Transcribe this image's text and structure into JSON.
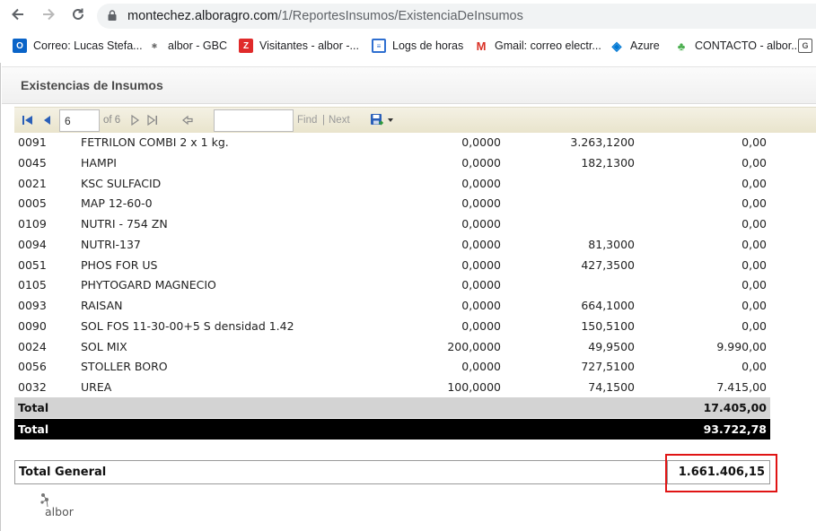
{
  "browser": {
    "url_host": "montechez.alboragro.com",
    "url_path": "/1/ReportesInsumos/ExistenciaDeInsumos",
    "bookmarks": [
      {
        "label": "Correo: Lucas Stefa...",
        "icon": "outlook-icon",
        "color": "#0a64c8"
      },
      {
        "label": "albor - GBC",
        "icon": "albor-icon",
        "color": "#6b6b6b"
      },
      {
        "label": "Visitantes - albor -...",
        "icon": "zoho-icon",
        "color": "#e02a2a"
      },
      {
        "label": "Logs de horas",
        "icon": "logs-icon",
        "color": "#2f6fd0"
      },
      {
        "label": "Gmail: correo electr...",
        "icon": "gmail-icon",
        "color": "#d93025"
      },
      {
        "label": "Azure",
        "icon": "azure-devops-icon",
        "color": "#0078d4"
      },
      {
        "label": "CONTACTO - albor...",
        "icon": "sprout-icon",
        "color": "#4caf50"
      }
    ]
  },
  "report": {
    "title": "Existencias de Insumos",
    "toolbar": {
      "page_value": "6",
      "of_label": "of 6",
      "find_label": "Find",
      "separator": "|",
      "next_label": "Next"
    },
    "rows": [
      {
        "code": "0091",
        "name": "FETRILON COMBI 2 x 1 kg.",
        "a": "0,0000",
        "b": "3.263,1200",
        "c": "0,00"
      },
      {
        "code": "0045",
        "name": "HAMPI",
        "a": "0,0000",
        "b": "182,1300",
        "c": "0,00"
      },
      {
        "code": "0021",
        "name": "KSC SULFACID",
        "a": "0,0000",
        "b": "",
        "c": "0,00"
      },
      {
        "code": "0005",
        "name": "MAP 12-60-0",
        "a": "0,0000",
        "b": "",
        "c": "0,00"
      },
      {
        "code": "0109",
        "name": "NUTRI - 754 ZN",
        "a": "0,0000",
        "b": "",
        "c": "0,00"
      },
      {
        "code": "0094",
        "name": "NUTRI-137",
        "a": "0,0000",
        "b": "81,3000",
        "c": "0,00"
      },
      {
        "code": "0051",
        "name": "PHOS FOR US",
        "a": "0,0000",
        "b": "427,3500",
        "c": "0,00"
      },
      {
        "code": "0105",
        "name": "PHYTOGARD MAGNECIO",
        "a": "0,0000",
        "b": "",
        "c": "0,00"
      },
      {
        "code": "0093",
        "name": "RAISAN",
        "a": "0,0000",
        "b": "664,1000",
        "c": "0,00"
      },
      {
        "code": "0090",
        "name": "SOL FOS 11-30-00+5 S densidad 1.42",
        "a": "0,0000",
        "b": "150,5100",
        "c": "0,00"
      },
      {
        "code": "0024",
        "name": "SOL MIX",
        "a": "200,0000",
        "b": "49,9500",
        "c": "9.990,00"
      },
      {
        "code": "0056",
        "name": "STOLLER BORO",
        "a": "0,0000",
        "b": "727,5100",
        "c": "0,00"
      },
      {
        "code": "0032",
        "name": "UREA",
        "a": "100,0000",
        "b": "74,1500",
        "c": "7.415,00"
      }
    ],
    "subtotal": {
      "label": "Total",
      "value": "17.405,00"
    },
    "grandtotal": {
      "label": "Total",
      "value": "93.722,78"
    },
    "general": {
      "label": "Total General",
      "value": "1.661.406,15"
    },
    "footer_logo_text": "albor",
    "highlight_color": "#e01414"
  }
}
